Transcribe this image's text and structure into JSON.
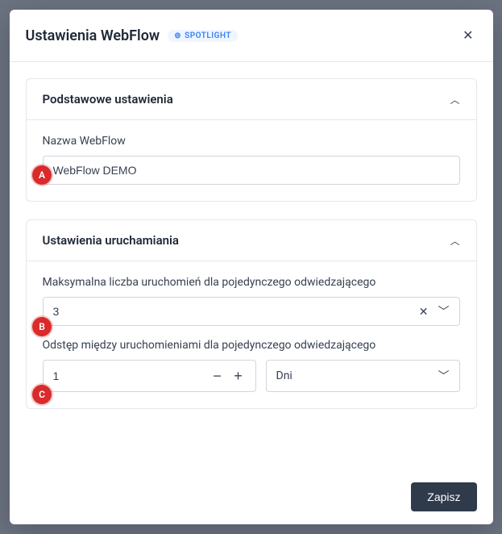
{
  "header": {
    "title": "Ustawienia WebFlow",
    "badge": "SPOTLIGHT"
  },
  "sections": {
    "basic": {
      "title": "Podstawowe ustawienia",
      "fields": {
        "name": {
          "label": "Nazwa WebFlow",
          "value": "WebFlow DEMO"
        }
      }
    },
    "runtime": {
      "title": "Ustawienia uruchamiania",
      "fields": {
        "maxRuns": {
          "label": "Maksymalna liczba uruchomień dla pojedynczego odwiedzającego",
          "value": "3"
        },
        "interval": {
          "label": "Odstęp między uruchomieniami dla pojedynczego odwiedzającego",
          "value": "1",
          "unit": "Dni"
        }
      }
    }
  },
  "footer": {
    "save": "Zapisz"
  },
  "markers": {
    "a": "A",
    "b": "B",
    "c": "C"
  }
}
